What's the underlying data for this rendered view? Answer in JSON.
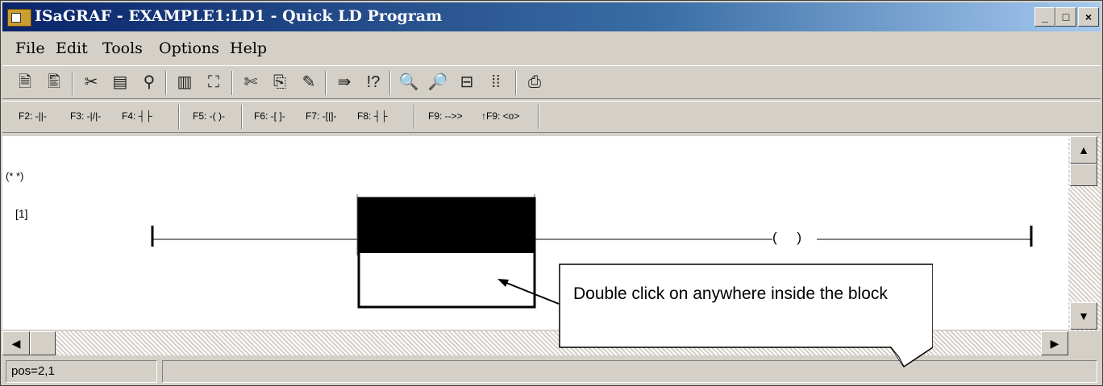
{
  "window": {
    "title": "ISaGRAF - EXAMPLE1:LD1 - Quick LD Program",
    "controls": [
      "_",
      "□",
      "×"
    ]
  },
  "menu": [
    "File",
    "Edit",
    "Tools",
    "Options",
    "Help"
  ],
  "toolbar_icons": [
    "new-doc-icon",
    "open-doc-icon",
    "cut-icon",
    "dictionary-icon",
    "program-icon",
    "library-icon",
    "block-icon",
    "scissors-icon",
    "copy-icon",
    "paste-icon",
    "jump-icon",
    "toggle-icon",
    "zoom-out-icon",
    "zoom-in-icon",
    "fit-icon",
    "grid-icon",
    "print-icon"
  ],
  "fkeys": [
    "F2: -||-",
    "F3: -|/|-",
    "F4: ┤├",
    "F5: -( )-",
    "F6: -[ ]-",
    "F7: -[|]-",
    "F8: ┤├",
    "F9: -->>",
    "↑F9: <o>"
  ],
  "canvas": {
    "comment": "(* *)",
    "rung_label": "[1]",
    "coil_symbol": "( )"
  },
  "status": {
    "position": "pos=2,1"
  },
  "callout": {
    "text": "Double click on anywhere inside the block"
  }
}
